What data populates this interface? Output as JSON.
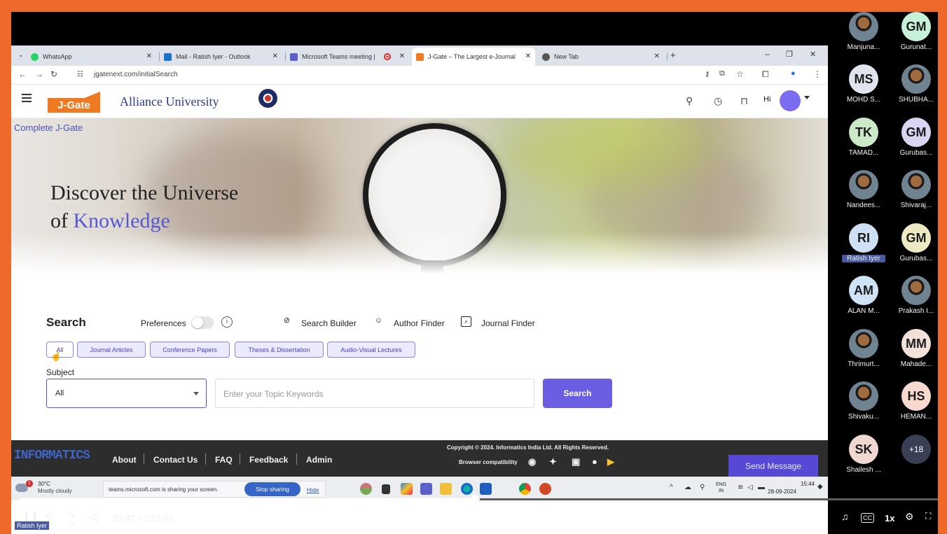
{
  "browser": {
    "tabs": [
      {
        "title": "WhatsApp",
        "favicon_color": "#25d366"
      },
      {
        "title": "Mail - Ratish Iyer - Outlook",
        "favicon_color": "#1a73c8"
      },
      {
        "title": "Microsoft Teams meeting |",
        "favicon_color": "#5b5fc7"
      },
      {
        "title": "J-Gate – The Largest e-Journal",
        "favicon_color": "#ef7a22"
      },
      {
        "title": "New Tab",
        "favicon_color": "#555555"
      }
    ],
    "url": "jgatenext.com/initialSearch"
  },
  "site": {
    "logo_text": "J-Gate",
    "university": "Alliance University",
    "greeting": "Hi",
    "collection_label": "Complete J-Gate",
    "hero_line1": "Discover the Universe",
    "hero_line2_prefix": "of",
    "hero_line2_accent": "Knowledge",
    "accent_color": "#6c5ee3"
  },
  "search": {
    "heading": "Search",
    "preferences_label": "Preferences",
    "tools": [
      "Search Builder",
      "Author Finder",
      "Journal Finder"
    ],
    "chips": [
      "All",
      "Journal Articles",
      "Conference Papers",
      "Theses & Dissertation",
      "Audio-Visual Lectures"
    ],
    "subject_label": "Subject",
    "subject_value": "All",
    "keyword_placeholder": "Enter your Topic Keywords",
    "button_label": "Search"
  },
  "footer": {
    "logo_text": "INFORMATICS",
    "links": [
      "About",
      "Contact Us",
      "FAQ",
      "Feedback",
      "Admin"
    ],
    "copyright": "Copyright © 2024. Informatics India Ltd. All Rights Reserved.",
    "compat_label": "Browser compatibility",
    "send_message": "Send Message"
  },
  "taskbar": {
    "weather_badge": "1",
    "temperature": "30°C",
    "weather_desc": "Mostly cloudy",
    "sharing_text": "teams.microsoft.com is sharing your screen.",
    "stop_sharing": "Stop sharing",
    "hide": "Hide",
    "lang_line1": "ENG",
    "lang_line2": "IN",
    "time": "15:44",
    "date": "28-09-2024"
  },
  "participants": [
    {
      "initials": "",
      "name": "Manjuna...",
      "photo": true
    },
    {
      "initials": "GM",
      "name": "Gurunat...",
      "color": "#c7f0d8"
    },
    {
      "initials": "MS",
      "name": "MOHD S...",
      "color": "#dfe4ee"
    },
    {
      "initials": "",
      "name": "SHUBHA...",
      "photo": true
    },
    {
      "initials": "TK",
      "name": "TAMAD...",
      "color": "#cbe8c7"
    },
    {
      "initials": "GM",
      "name": "Gurubas...",
      "color": "#d8d4f2"
    },
    {
      "initials": "",
      "name": "Nandees...",
      "photo": true
    },
    {
      "initials": "",
      "name": "Shivaraj...",
      "photo": true
    },
    {
      "initials": "RI",
      "name": "Ratish Iyer",
      "color": "#cfe0f4",
      "highlight": true
    },
    {
      "initials": "GM",
      "name": "Gurubas...",
      "color": "#ede9c2"
    },
    {
      "initials": "AM",
      "name": "ALAN M...",
      "color": "#cfe3f6"
    },
    {
      "initials": "",
      "name": "Prakash I...",
      "photo": true
    },
    {
      "initials": "",
      "name": "Thrimurt...",
      "photo": true
    },
    {
      "initials": "MM",
      "name": "Mahade...",
      "color": "#f2e1d9"
    },
    {
      "initials": "",
      "name": "Shivaku...",
      "photo": true
    },
    {
      "initials": "HS",
      "name": "HEMAN...",
      "color": "#f7d9d0"
    },
    {
      "initials": "SK",
      "name": "Shailesh ...",
      "color": "#f1d7d2"
    },
    {
      "initials": "+18",
      "name": "",
      "more": true
    }
  ],
  "player": {
    "progress_fraction": 0.4952,
    "current_time": "39:47",
    "total_time": "1:21:02",
    "time_readout": "39:47 / 1:21:02",
    "presenter": "Ratish Iyer",
    "skip_back_label": "10",
    "skip_forward_label": "10",
    "speed": "1x"
  }
}
